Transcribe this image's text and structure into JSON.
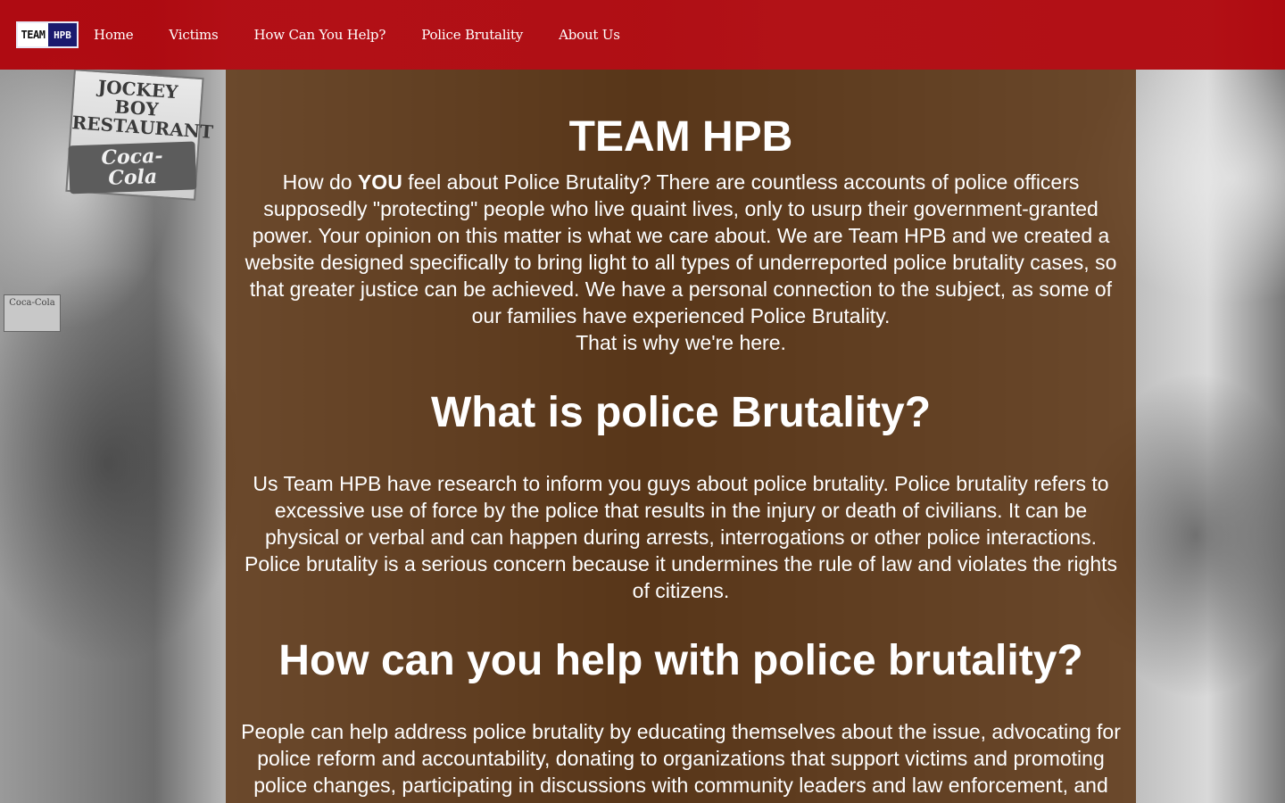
{
  "nav": {
    "logo_left": "TEAM",
    "logo_right": "HPB",
    "items": [
      "Home",
      "Victims",
      "How Can You Help?",
      "Police Brutality",
      "About Us"
    ]
  },
  "background": {
    "sign_line1": "JOCKEY BOY",
    "sign_line2": "RESTAURANT",
    "sign_brand": "Coca-Cola",
    "small_sign": "Coca-Cola"
  },
  "hero": {
    "title": "TEAM HPB",
    "intro_before": "How do ",
    "intro_emphasis": "YOU",
    "intro_after": " feel about Police Brutality? There are countless accounts of police officers supposedly \"protecting\" people who live quaint lives, only to usurp their government-granted power. Your opinion on this matter is what we care about. We are Team HPB and we created a website designed specifically to bring light to all types of underreported police brutality cases, so that greater justice can be achieved. We have a personal connection to the subject, as some of our families have experienced Police Brutality.",
    "intro_closing": "That is why we're here."
  },
  "sections": {
    "what_title": "What is police Brutality?",
    "what_body": "Us Team HPB have research to inform you guys about police brutality. Police brutality refers to excessive use of force by the police that results in the injury or death of civilians. It can be physical or verbal and can happen during arrests, interrogations or other police interactions. Police brutality is a serious concern because it undermines the rule of law and violates the rights of citizens.",
    "help_title": "How can you help with police brutality?",
    "help_body": "People can help address police brutality by educating themselves about the issue, advocating for police reform and accountability, donating to organizations that support victims and promoting police changes, participating in discussions with community leaders and law enforcement, and attending peaceful protests."
  },
  "colors": {
    "nav_red": "#b0050c",
    "panel_brown": "#562c08",
    "logo_blue": "#1b1a6e"
  }
}
